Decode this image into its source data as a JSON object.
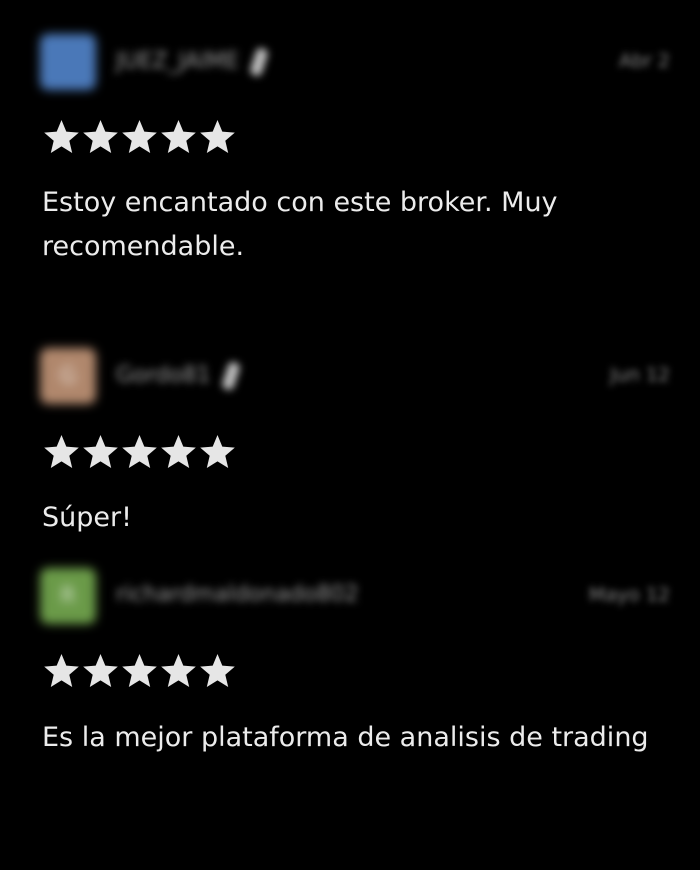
{
  "colors": {
    "background": "#000000",
    "star": "#e6e6e6",
    "text": "#ececec",
    "muted": "#8a8a8a"
  },
  "reviews": [
    {
      "username": "JUEZ_JAIME",
      "date": "Abr 2",
      "rating": 5,
      "text": "Estoy encantado con este broker. Muy recomendable.",
      "avatar_initial": "",
      "avatar_color": "#4a78b8",
      "verified": true
    },
    {
      "username": "Gordo81",
      "date": "Jun 12",
      "rating": 5,
      "text": "Súper!",
      "avatar_initial": "G",
      "avatar_color": "#b0876c",
      "verified": true
    },
    {
      "username": "richardmaldonado802",
      "date": "Mayo 12",
      "rating": 5,
      "text": "Es la mejor plataforma de analisis de trading",
      "avatar_initial": "R",
      "avatar_color": "#6a9a48",
      "verified": false
    }
  ]
}
